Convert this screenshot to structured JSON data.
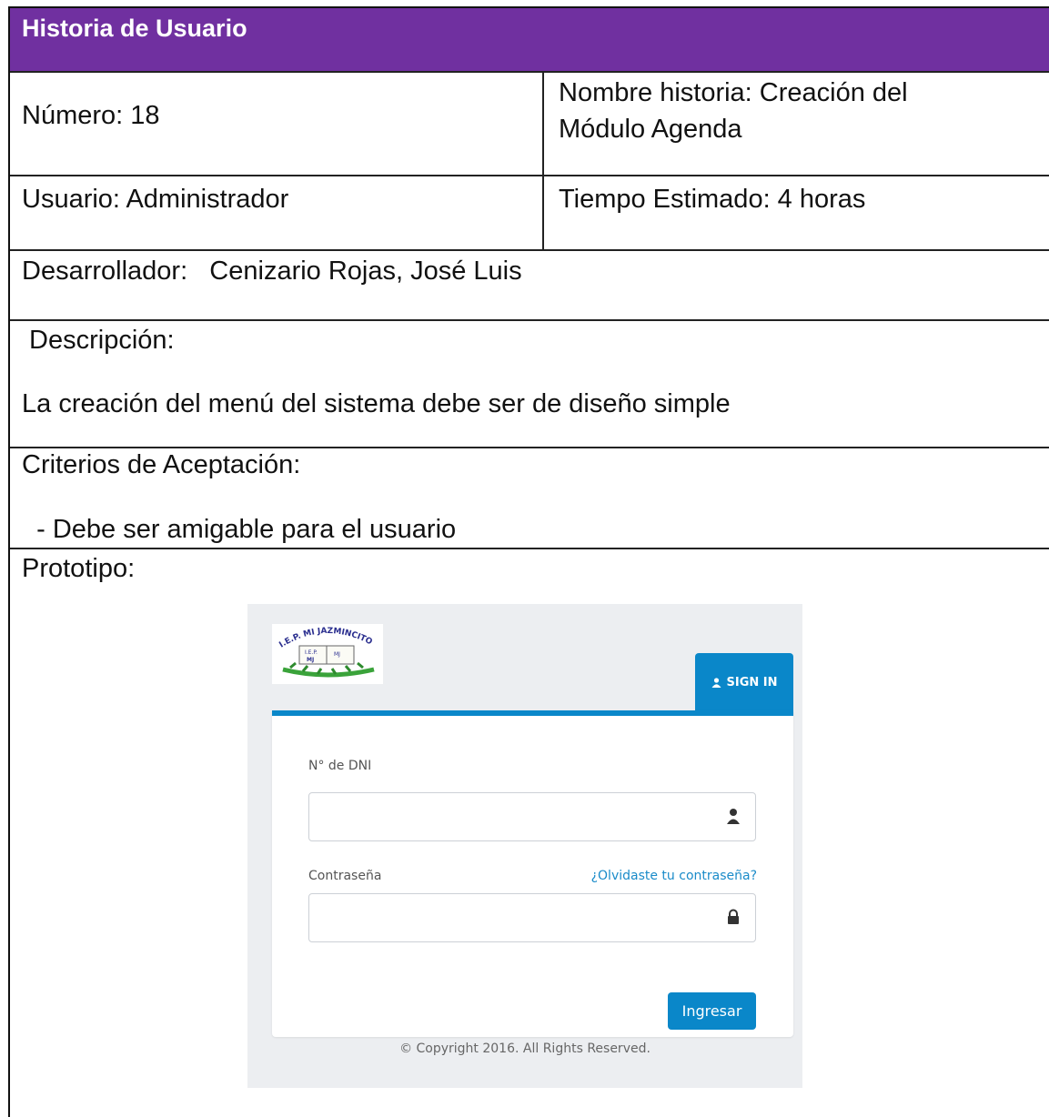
{
  "header": {
    "title": "Historia de Usuario"
  },
  "story": {
    "number": "Número: 18",
    "name_line1": "Nombre historia: Creación del",
    "name_line2": "Módulo Agenda",
    "user": "Usuario: Administrador",
    "estimated_time": "Tiempo Estimado: 4 horas",
    "developer": "Desarrollador:   Cenizario Rojas, José Luis",
    "description_label": " Descripción:",
    "description": "La creación del menú del sistema debe ser de diseño simple",
    "criteria_label": "Criterios de Aceptación:",
    "criteria_item": "  - Debe ser amigable para el usuario",
    "prototype_label": "Prototipo:"
  },
  "prototype": {
    "logo_text": "I.E.P. MI JAZMINCITO",
    "logo_book_left": "I.E.P.",
    "logo_book_left2": "MJ",
    "logo_book_right": "MJ",
    "tab_label": "SIGN IN",
    "dni_label": "N° de DNI",
    "password_label": "Contraseña",
    "forgot_link": "¿Olvidaste tu contraseña?",
    "submit_label": "Ingresar",
    "copyright": "© Copyright 2016. All Rights Reserved.",
    "accent_color": "#0a87c9",
    "header_color": "#7030a0",
    "icons": {
      "tab": "user-icon",
      "dni": "user-icon",
      "password": "lock-icon"
    }
  }
}
